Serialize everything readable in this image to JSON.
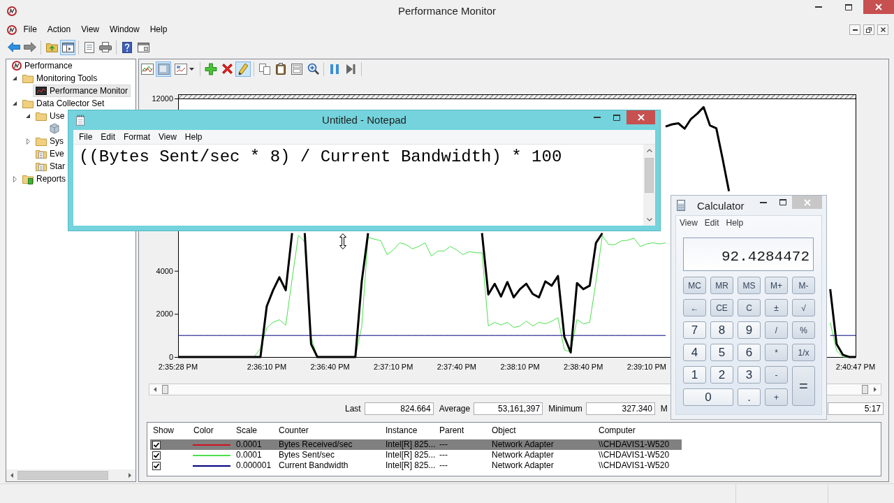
{
  "window": {
    "title": "Performance Monitor"
  },
  "menu": [
    "File",
    "Action",
    "View",
    "Window",
    "Help"
  ],
  "toolbar": [
    {
      "pressed": false
    },
    {
      "pressed": false
    },
    {
      "pressed": false
    },
    {
      "pressed": true
    },
    {
      "pressed": false
    },
    {
      "pressed": false
    },
    {
      "pressed": false
    },
    {
      "pressed": false
    }
  ],
  "tree": [
    {
      "label": "Performance",
      "selected": false,
      "kind": "root",
      "children": [
        {
          "label": "Monitoring Tools",
          "selected": false,
          "expanded": true,
          "kind": "folder",
          "children": [
            {
              "label": "Performance Monitor",
              "selected": true,
              "kind": "monitor"
            }
          ]
        },
        {
          "label": "Data Collector Set",
          "selected": false,
          "expanded": true,
          "kind": "folder",
          "children": [
            {
              "label": "Use",
              "selected": false,
              "expanded": true,
              "kind": "folder",
              "children": [
                {
                  "selected": false,
                  "kind": "set"
                }
              ]
            },
            {
              "label": "Sys",
              "selected": false,
              "expanded": false,
              "kind": "folder"
            },
            {
              "label": "Eve",
              "selected": false,
              "kind": "log"
            },
            {
              "label": "Star",
              "selected": false,
              "kind": "log"
            }
          ]
        },
        {
          "label": "Reports",
          "selected": false,
          "expanded": false,
          "kind": "report"
        }
      ]
    }
  ],
  "graph_toolbar": [
    {
      "pressed": false
    },
    {
      "pressed": true
    },
    {
      "pressed": false
    },
    {
      "pressed": false
    },
    {
      "pressed": false
    },
    {
      "pressed": true
    },
    {
      "pressed": false
    },
    {
      "pressed": false
    },
    {
      "pressed": false
    },
    {
      "pressed": false
    },
    {
      "pressed": false
    },
    {
      "pressed": false
    }
  ],
  "graph": {
    "chart_data": {
      "type": "line",
      "categories": [
        "2:35:28 PM",
        null,
        null,
        null,
        null,
        null,
        null,
        null,
        null,
        null,
        null,
        null,
        null,
        null,
        "2:36:10 PM",
        null,
        null,
        null,
        null,
        null,
        null,
        null,
        null,
        null,
        "2:36:40 PM",
        null,
        null,
        null,
        null,
        null,
        null,
        null,
        null,
        null,
        "2:37:10 PM",
        null,
        null,
        null,
        null,
        null,
        null,
        null,
        null,
        null,
        "2:37:40 PM",
        null,
        null,
        null,
        null,
        null,
        null,
        null,
        null,
        null,
        "2:38:10 PM",
        null,
        null,
        null,
        null,
        null,
        null,
        null,
        null,
        null,
        "2:38:40 PM",
        null,
        null,
        null,
        null,
        null,
        null,
        null,
        null,
        null,
        "2:39:10 PM",
        null,
        null,
        null,
        null,
        null,
        null,
        null,
        null,
        null,
        null,
        null,
        null,
        null,
        null,
        null,
        null,
        null,
        null,
        null,
        null,
        null,
        null,
        null,
        null,
        null,
        null,
        null,
        null,
        null,
        null,
        null,
        null,
        "2:40:47 PM"
      ],
      "ylim": [
        0,
        12000
      ],
      "yticks": [
        0,
        2000,
        4000,
        12000
      ],
      "series": [
        {
          "color": "#000000",
          "values": [
            0,
            0,
            0,
            0,
            0,
            0,
            0,
            0,
            0,
            0,
            0,
            0,
            0,
            0,
            2350,
            3100,
            3700,
            3100,
            5750,
            null,
            5750,
            600,
            0,
            0,
            0,
            0,
            0,
            0,
            0,
            3500,
            5750,
            null,
            null,
            null,
            null,
            null,
            null,
            null,
            null,
            null,
            null,
            null,
            null,
            null,
            null,
            null,
            null,
            null,
            5750,
            2900,
            3400,
            2810,
            3480,
            2770,
            3150,
            3400,
            2930,
            2770,
            3510,
            3310,
            3760,
            940,
            210,
            3430,
            3150,
            3310,
            5300,
            5750,
            null,
            null,
            null,
            null,
            null,
            null,
            null,
            null,
            null,
            10700,
            10800,
            10850,
            10600,
            11050,
            11300,
            11600,
            10750,
            10620,
            9200,
            7700,
            null,
            null,
            null,
            null,
            null,
            null,
            null,
            null,
            null,
            null,
            null,
            null,
            null,
            null,
            null,
            3150,
            600,
            100,
            0,
            0
          ]
        },
        {
          "color": "#4ce04c",
          "values": [
            null,
            null,
            null,
            null,
            null,
            null,
            null,
            null,
            null,
            null,
            null,
            0,
            0,
            400,
            1350,
            1610,
            1730,
            1480,
            3600,
            5650,
            5350,
            900,
            0,
            0,
            0,
            0,
            0,
            0,
            0,
            1400,
            5560,
            5470,
            5400,
            4750,
            4970,
            5300,
            5220,
            5020,
            5130,
            5300,
            4690,
            4920,
            4920,
            5130,
            4970,
            4750,
            4890,
            4840,
            4840,
            1440,
            1610,
            1490,
            1610,
            1370,
            1440,
            1660,
            1440,
            1610,
            1540,
            1660,
            1820,
            330,
            240,
            1740,
            1540,
            1610,
            3500,
            5630,
            5220,
            5220,
            5390,
            5420,
            5520,
            5130,
            5250,
            5300,
            5250,
            5300,
            null,
            null,
            null,
            null,
            null,
            null,
            null,
            null,
            null,
            null,
            null,
            null,
            null,
            null,
            null,
            null,
            null,
            null,
            null,
            null,
            null,
            null,
            null,
            null,
            null,
            1600,
            300,
            0,
            0,
            0
          ]
        },
        {
          "color": "#000080",
          "values": [
            1000,
            1000,
            1000,
            1000,
            1000,
            1000,
            1000,
            1000,
            1000,
            1000,
            1000,
            1000,
            1000,
            1000,
            1000,
            1000,
            1000,
            1000,
            1000,
            1000,
            1000,
            1000,
            1000,
            1000,
            1000,
            1000,
            1000,
            1000,
            1000,
            1000,
            1000,
            1000,
            1000,
            1000,
            1000,
            1000,
            1000,
            1000,
            1000,
            1000,
            1000,
            1000,
            1000,
            1000,
            1000,
            1000,
            1000,
            1000,
            1000,
            1000,
            1000,
            1000,
            1000,
            1000,
            1000,
            1000,
            1000,
            1000,
            1000,
            1000,
            1000,
            1000,
            1000,
            1000,
            1000,
            1000,
            1000,
            1000,
            1000,
            1000,
            1000,
            1000,
            1000,
            1000,
            1000,
            1000,
            1000,
            1000,
            null,
            null,
            null,
            null,
            null,
            null,
            null,
            null,
            null,
            null,
            null,
            null,
            null,
            null,
            null,
            null,
            null,
            null,
            null,
            null,
            null,
            null,
            null,
            null,
            null,
            1000,
            1000,
            1000,
            1000,
            1000
          ]
        }
      ]
    }
  },
  "stats": [
    {
      "label": "Last",
      "value": "824.664"
    },
    {
      "label": "Average",
      "value": "53,161,397"
    },
    {
      "label": "Minimum",
      "value": "327.340"
    },
    {
      "label": "M"
    },
    {
      "value": "5:17"
    }
  ],
  "counters": {
    "columns": [
      "Show",
      "Color",
      "Scale",
      "Counter",
      "Instance",
      "Parent",
      "Object",
      "Computer"
    ],
    "rows": [
      {
        "shown": true,
        "selected": true,
        "color": "#d01020",
        "scale": "0.0001",
        "counter": "Bytes Received/sec",
        "instance": "Intel[R] 825...",
        "parent": "---",
        "object": "Network Adapter",
        "computer": "\\\\CHDAVIS1-W520"
      },
      {
        "shown": true,
        "selected": false,
        "color": "#4ce04c",
        "scale": "0.0001",
        "counter": "Bytes Sent/sec",
        "instance": "Intel[R] 825...",
        "parent": "---",
        "object": "Network Adapter",
        "computer": "\\\\CHDAVIS1-W520"
      },
      {
        "shown": true,
        "selected": false,
        "color": "#000080",
        "scale": "0.000001",
        "counter": "Current Bandwidth",
        "instance": "Intel[R] 825...",
        "parent": "---",
        "object": "Network Adapter",
        "computer": "\\\\CHDAVIS1-W520"
      }
    ]
  },
  "notepad": {
    "title": "Untitled - Notepad",
    "active": true,
    "menu": [
      "File",
      "Edit",
      "Format",
      "View",
      "Help"
    ],
    "text": "((Bytes Sent/sec * 8) / Current Bandwidth) * 100"
  },
  "calculator": {
    "title": "Calculator",
    "active": false,
    "menu": [
      "View",
      "Edit",
      "Help"
    ],
    "display": "92.4284472",
    "keys": [
      {
        "label": "MC",
        "kind": "key"
      },
      {
        "label": "MR",
        "kind": "key"
      },
      {
        "label": "MS",
        "kind": "key"
      },
      {
        "label": "M+",
        "kind": "key"
      },
      {
        "label": "M-",
        "kind": "key"
      },
      {
        "label": "←",
        "kind": "key"
      },
      {
        "label": "CE",
        "kind": "key"
      },
      {
        "label": "C",
        "kind": "key"
      },
      {
        "label": "±",
        "kind": "key"
      },
      {
        "label": "√",
        "kind": "key"
      },
      {
        "label": "7",
        "kind": "digit"
      },
      {
        "label": "8",
        "kind": "digit"
      },
      {
        "label": "9",
        "kind": "digit"
      },
      {
        "label": "/",
        "kind": "key"
      },
      {
        "label": "%",
        "kind": "key"
      },
      {
        "label": "4",
        "kind": "digit"
      },
      {
        "label": "5",
        "kind": "digit"
      },
      {
        "label": "6",
        "kind": "digit"
      },
      {
        "label": "*",
        "kind": "key"
      },
      {
        "label": "1/x",
        "kind": "key"
      },
      {
        "label": "1",
        "kind": "digit"
      },
      {
        "label": "2",
        "kind": "digit"
      },
      {
        "label": "3",
        "kind": "digit"
      },
      {
        "label": "-",
        "kind": "key"
      },
      {
        "label": "=",
        "kind": "tall"
      },
      {
        "label": "0",
        "kind": "wide"
      },
      {
        "label": ".",
        "kind": "digit"
      },
      {
        "label": "+",
        "kind": "key"
      }
    ]
  }
}
